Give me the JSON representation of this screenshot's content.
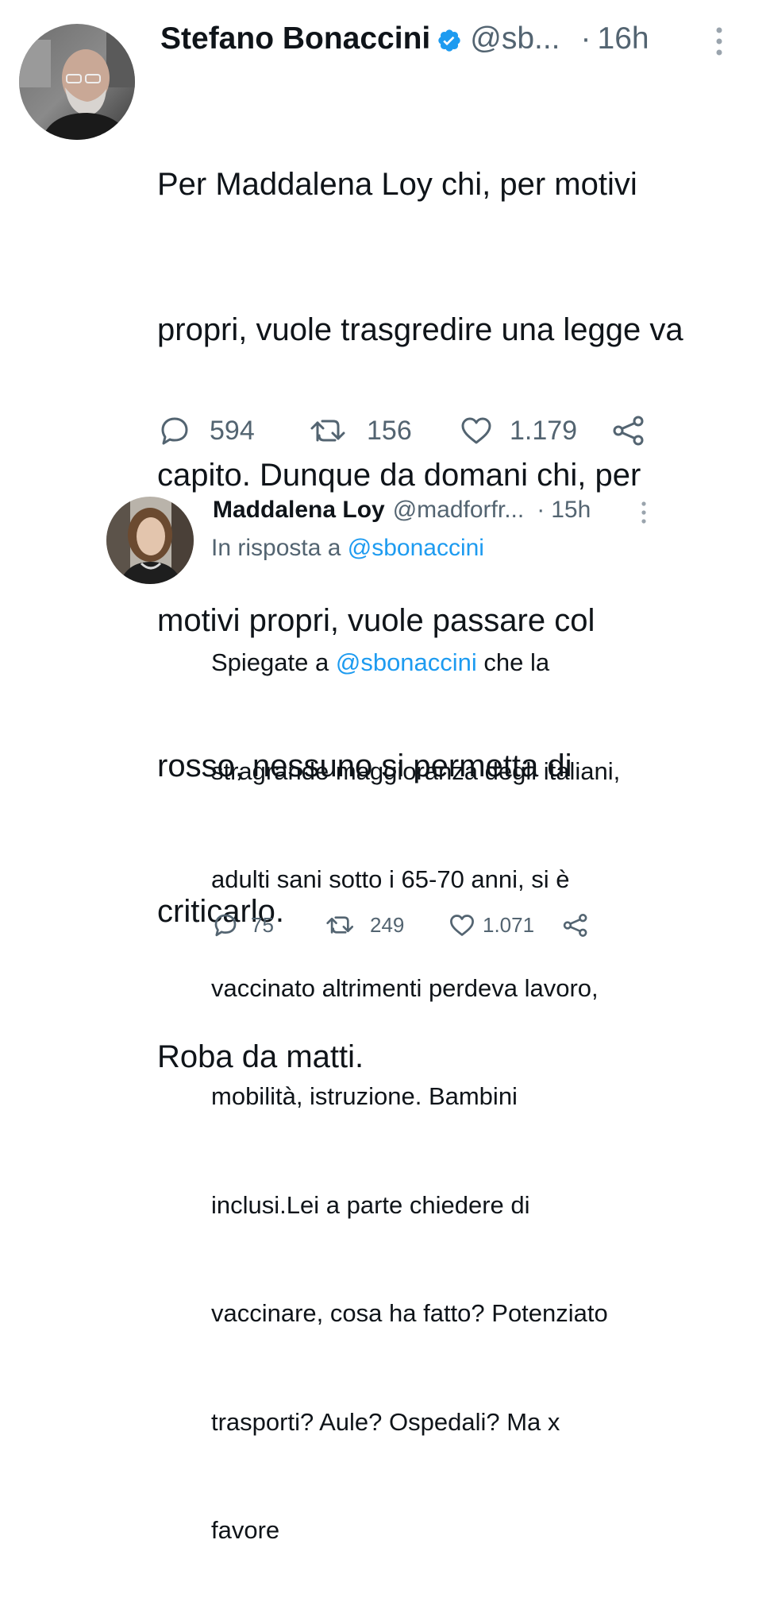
{
  "tweet1": {
    "author_name": "Stefano Bonaccini",
    "handle": "@sb...",
    "separator": "·",
    "time": "16h",
    "body_lines": [
      "Per Maddalena Loy chi, per motivi",
      "propri, vuole trasgredire una legge va",
      "capito. Dunque da domani chi, per",
      "motivi propri, vuole passare col",
      "rosso, nessuno si permetta di",
      "criticarlo.",
      "Roba da matti."
    ],
    "replies": "594",
    "retweets": "156",
    "likes": "1.179",
    "verified_color": "#1d9bf0"
  },
  "tweet2": {
    "author_name": "Maddalena Loy",
    "handle": "@madforfr...",
    "separator": "·",
    "time": "15h",
    "reply_prefix": "In risposta a",
    "reply_mention": "@sbonaccini",
    "body_first_prefix": "Spiegate a ",
    "body_first_mention": "@sbonaccini",
    "body_first_suffix": " che la",
    "body_lines": [
      "stragrande maggioranza degli italiani,",
      "adulti sani sotto i 65-70 anni, si è",
      "vaccinato altrimenti perdeva lavoro,",
      "mobilità, istruzione. Bambini",
      "inclusi.Lei a parte chiedere di",
      "vaccinare, cosa ha fatto? Potenziato",
      "trasporti? Aule? Ospedali? Ma x",
      "favore"
    ],
    "replies": "75",
    "retweets": "249",
    "likes": "1.071"
  },
  "colors": {
    "text": "#0f1419",
    "secondary": "#536471",
    "link": "#1d9bf0"
  }
}
